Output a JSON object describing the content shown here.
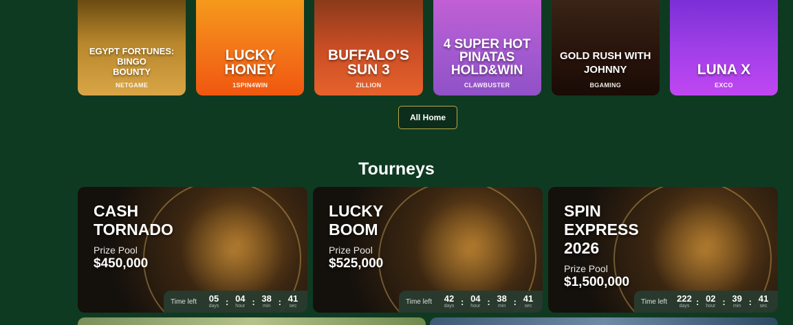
{
  "games": [
    {
      "title": "EGYPT FORTUNES:\nBINGO\nBOUNTY",
      "provider": "NETGAME",
      "size": "t-big",
      "style": "g1",
      "art_text": "FORTUNES\nBINGO BOUNTY"
    },
    {
      "title": "LUCKY\nHONEY",
      "provider": "1SPIN4WIN",
      "size": "t-big",
      "style": "g2"
    },
    {
      "title": "BUFFALO'S\nSUN 3",
      "provider": "ZILLION",
      "size": "t-big",
      "style": "g3"
    },
    {
      "title": "4 SUPER HOT\nPINATAS\nHOLD&WIN",
      "provider": "CLAWBUSTER",
      "size": "t-big",
      "style": "g4"
    },
    {
      "title": "GOLD RUSH WITH\nJOHNNY",
      "provider": "BGAMING",
      "size": "t-big",
      "style": "g5"
    },
    {
      "title": "LUNA X",
      "provider": "EXCO",
      "size": "t-big",
      "style": "g6"
    }
  ],
  "all_home_label": "All Home",
  "section_title": "Tourneys",
  "tourneys": [
    {
      "name": "CASH\nTORNADO",
      "prize_label": "Prize Pool",
      "prize": "$450,000",
      "time_left_label": "Time left",
      "days": "05",
      "hours": "04",
      "mins": "38",
      "secs": "41"
    },
    {
      "name": "LUCKY\nBOOM",
      "prize_label": "Prize Pool",
      "prize": "$525,000",
      "time_left_label": "Time left",
      "days": "42",
      "hours": "04",
      "mins": "38",
      "secs": "41"
    },
    {
      "name": "SPIN\nEXPRESS\n2026",
      "prize_label": "Prize Pool",
      "prize": "$1,500,000",
      "time_left_label": "Time left",
      "days": "222",
      "hours": "02",
      "mins": "39",
      "secs": "41"
    }
  ],
  "timer_units": {
    "days": "days",
    "hours": "hour",
    "mins": "min",
    "secs": "sec"
  }
}
